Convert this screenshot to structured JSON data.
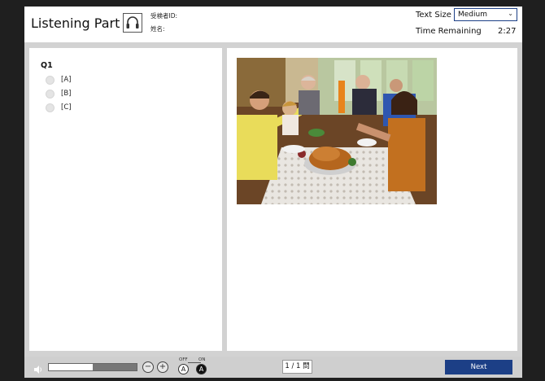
{
  "header": {
    "title": "Listening Part A",
    "examinee_id_label": "受検者ID:",
    "name_label": "姓名:",
    "text_size_label": "Text Size",
    "text_size_value": "Medium",
    "time_remaining_label": "Time Remaining",
    "time_remaining_value": "2:27",
    "icon": "headphones-icon"
  },
  "question": {
    "label": "Q1",
    "choices": [
      "[A]",
      "[B]",
      "[C]"
    ]
  },
  "footer": {
    "volume_level": 0.5,
    "volume_down_label": "−",
    "volume_up_label": "+",
    "furigana_off_label": "OFF",
    "furigana_on_label": "ON",
    "furigana_off_glyph": "A",
    "furigana_on_glyph": "A",
    "page_indicator": "1 / 1 問",
    "next_label": "Next"
  },
  "colors": {
    "accent": "#1c3f86",
    "frame": "#1f1f1f",
    "panel_bg": "#d2d2d2"
  }
}
